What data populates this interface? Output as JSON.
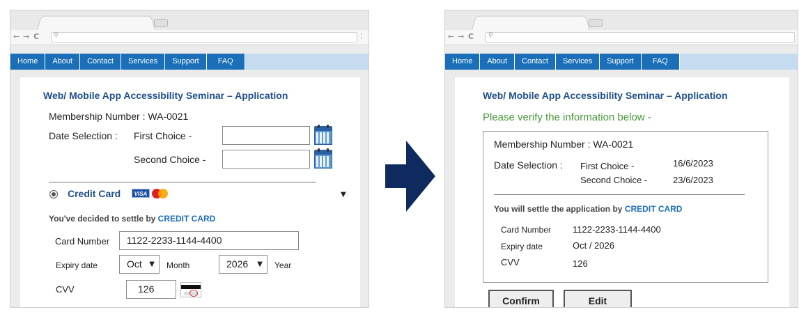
{
  "left": {
    "nav": [
      "Home",
      "About",
      "Contact",
      "Services",
      "Support",
      "FAQ"
    ],
    "title": "Web/ Mobile App Accessibility Seminar – Application",
    "membership_label": "Membership Number :",
    "membership_value": "WA-0021",
    "date_label": "Date Selection :",
    "first_choice_label": "First Choice -",
    "second_choice_label": "Second Choice -",
    "first_choice_value": "",
    "second_choice_value": "",
    "payment_label": "Credit Card",
    "visa_text": "VISA",
    "settle_prefix": "You've decided to settle by ",
    "settle_method": "CREDIT CARD",
    "card_number_label": "Card Number",
    "card_number_value": "1122-2233-1144-4400",
    "expiry_label": "Expiry date",
    "month_value": "Oct",
    "month_label": "Month",
    "year_value": "2026",
    "year_label": "Year",
    "cvv_label": "CVV",
    "cvv_value": "126"
  },
  "right": {
    "nav": [
      "Home",
      "About",
      "Contact",
      "Services",
      "Support",
      "FAQ"
    ],
    "title": "Web/ Mobile App Accessibility Seminar – Application",
    "verify_text": "Please verify the information below -",
    "membership_label": "Membership Number :",
    "membership_value": "WA-0021",
    "date_label": "Date Selection :",
    "first_choice_label": "First Choice -",
    "first_choice_value": "16/6/2023",
    "second_choice_label": "Second Choice -",
    "second_choice_value": "23/6/2023",
    "settle_prefix": "You will settle the application by ",
    "settle_method": "CREDIT CARD",
    "card_number_label": "Card Number",
    "card_number_value": "1122-2233-1144-4400",
    "expiry_label": "Expiry date",
    "expiry_value": "Oct / 2026",
    "cvv_label": "CVV",
    "cvv_value": "126",
    "confirm_label": "Confirm",
    "edit_label": "Edit"
  },
  "colors": {
    "nav_bg": "#1a6fb8",
    "title": "#1f4f8b",
    "verify": "#4a9a3c",
    "arrow": "#0f2a5e"
  }
}
